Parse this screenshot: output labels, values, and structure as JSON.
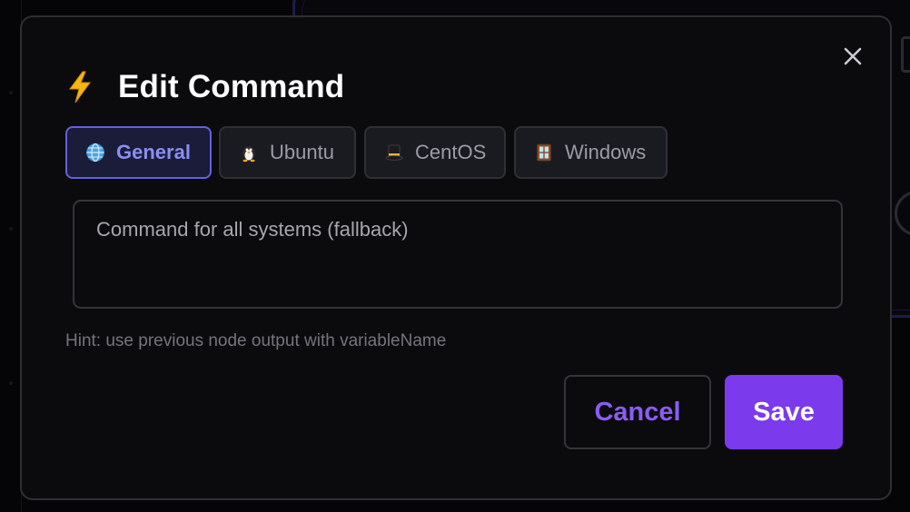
{
  "dialog": {
    "title": "Edit Command",
    "title_icon": "lightning-icon",
    "close_icon": "close-icon"
  },
  "tabs": [
    {
      "label": "General",
      "icon": "globe-icon",
      "active": true
    },
    {
      "label": "Ubuntu",
      "icon": "penguin-icon",
      "active": false
    },
    {
      "label": "CentOS",
      "icon": "top-hat-icon",
      "active": false
    },
    {
      "label": "Windows",
      "icon": "window-icon",
      "active": false
    }
  ],
  "command_input": {
    "value": "",
    "placeholder": "Command for all systems (fallback)"
  },
  "hint": "Hint: use previous node output with variableName",
  "actions": {
    "cancel_label": "Cancel",
    "save_label": "Save"
  },
  "colors": {
    "accent": "#7c3aed",
    "active_tab_border": "#6063dd",
    "active_tab_text": "#8b8ef0",
    "modal_bg": "#0b0b0e"
  }
}
